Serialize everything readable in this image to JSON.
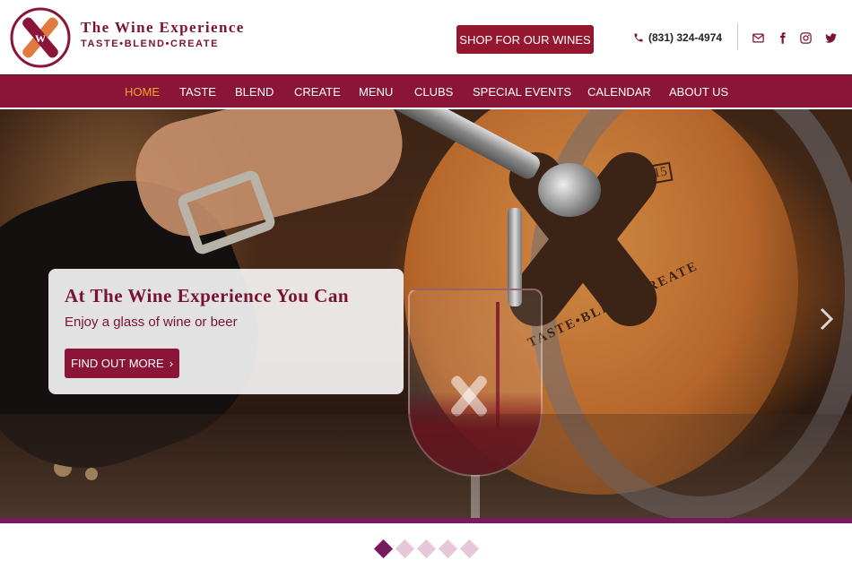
{
  "brand": {
    "title": "The Wine Experience",
    "tagline": "TASTE•BLEND•CREATE",
    "logo_letter": "W",
    "colors": {
      "primary": "#8a1538",
      "accent": "#f5a623",
      "indicator": "#7a1a5e"
    }
  },
  "header": {
    "shop_label": "SHOP FOR OUR WINES",
    "phone": "(831) 324-4974",
    "social": [
      {
        "icon": "email-icon"
      },
      {
        "icon": "facebook-icon"
      },
      {
        "icon": "instagram-icon"
      },
      {
        "icon": "twitter-icon"
      }
    ]
  },
  "nav": {
    "items": [
      {
        "label": "HOME",
        "active": true
      },
      {
        "label": "TASTE"
      },
      {
        "label": "BLEND"
      },
      {
        "label": "CREATE"
      },
      {
        "label": "MENU"
      },
      {
        "label": "CLUBS"
      },
      {
        "label": "SPECIAL EVENTS"
      },
      {
        "label": "CALENDAR"
      },
      {
        "label": "ABOUT US"
      }
    ]
  },
  "hero": {
    "title": "At The Wine Experience You Can",
    "subtitle": "Enjoy a glass of wine or beer",
    "button_label": "FIND OUT MORE",
    "barrel_year": "2015",
    "barrel_text": "TASTE•BLEND•CREATE",
    "slides_total": 5,
    "active_slide": 1
  }
}
